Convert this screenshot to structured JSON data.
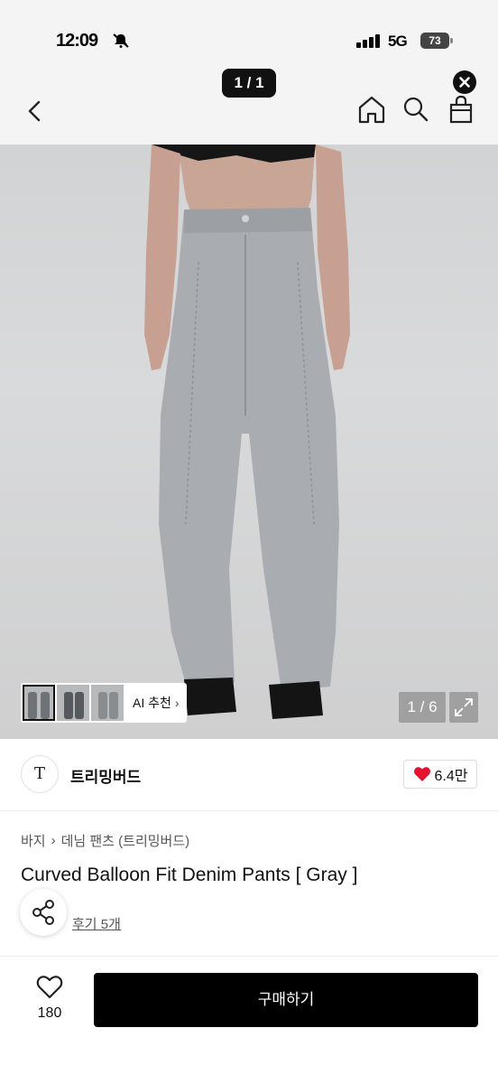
{
  "status_bar": {
    "time": "12:09",
    "network": "5G",
    "battery": "73"
  },
  "header": {
    "page_counter": "1 / 1",
    "icons": [
      "back-icon",
      "home-icon",
      "search-icon",
      "bag-icon",
      "close-icon"
    ]
  },
  "gallery": {
    "ai_recommend_label": "AI 추천",
    "image_index": "1 / 6",
    "current_image": 1,
    "total_images": 6
  },
  "brand": {
    "logo_text": "T",
    "name": "트리밍버드",
    "likes": "6.4만"
  },
  "product": {
    "breadcrumb": [
      "바지",
      "데님 팬츠 (트리밍버드)"
    ],
    "title": "Curved Balloon Fit Denim Pants [ Gray ]",
    "reviews": "후기 5개"
  },
  "actions": {
    "wish_count": "180",
    "buy_label": "구매하기"
  },
  "colors": {
    "accent": "#000000",
    "heart": "#e8112d",
    "header_bg": "#f4f4f4"
  }
}
